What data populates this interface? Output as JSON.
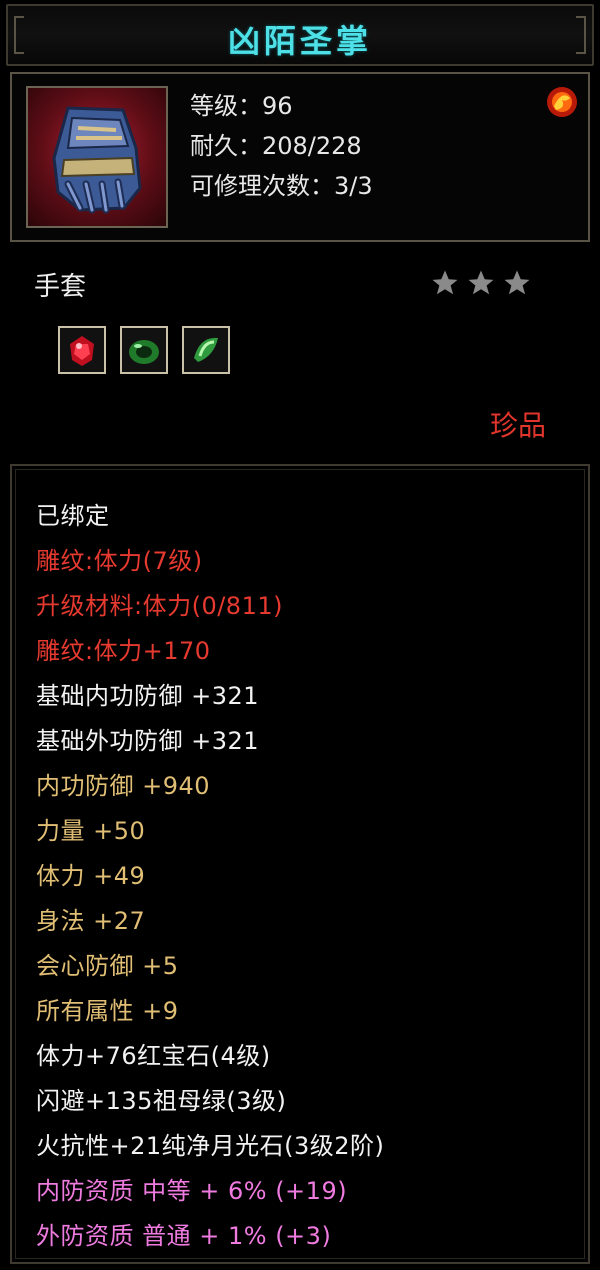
{
  "item": {
    "name": "凶陌圣掌",
    "level": "等级：96",
    "durability": "耐久：208/228",
    "repair_count": "可修理次数：3/3",
    "type": "手套",
    "star_rating": 3,
    "rarity": "珍品"
  },
  "colors": {
    "title": "#4de0e6",
    "red": "#e63a30",
    "gold": "#e0be74",
    "pink": "#f07be0",
    "white": "#f2f2f2"
  },
  "icons": {
    "item_icon": "gauntlet-icon",
    "special_icon": "flame-orb-icon",
    "gems": [
      "ruby-icon",
      "emerald-icon",
      "moonstone-icon"
    ]
  },
  "stats": {
    "bound": "已绑定",
    "engrave": "雕纹:体力(7级)",
    "upgrade_material": "升级材料:体力(0/811)",
    "engrave_bonus": "雕纹:体力+170",
    "base_inner_def": "基础内功防御 +321",
    "base_outer_def": "基础外功防御 +321",
    "inner_def": "内功防御 +940",
    "strength": "力量 +50",
    "stamina": "体力 +49",
    "agility": "身法 +27",
    "crit_def": "会心防御 +5",
    "all_attr": "所有属性 +9",
    "gem1": "体力+76红宝石(4级)",
    "gem2": "闪避+135祖母绿(3级)",
    "gem3": "火抗性+21纯净月光石(3级2阶)",
    "inner_quality": "内防资质 中等 + 6% (+19)",
    "outer_quality": "外防资质 普通 + 1% (+3)"
  }
}
